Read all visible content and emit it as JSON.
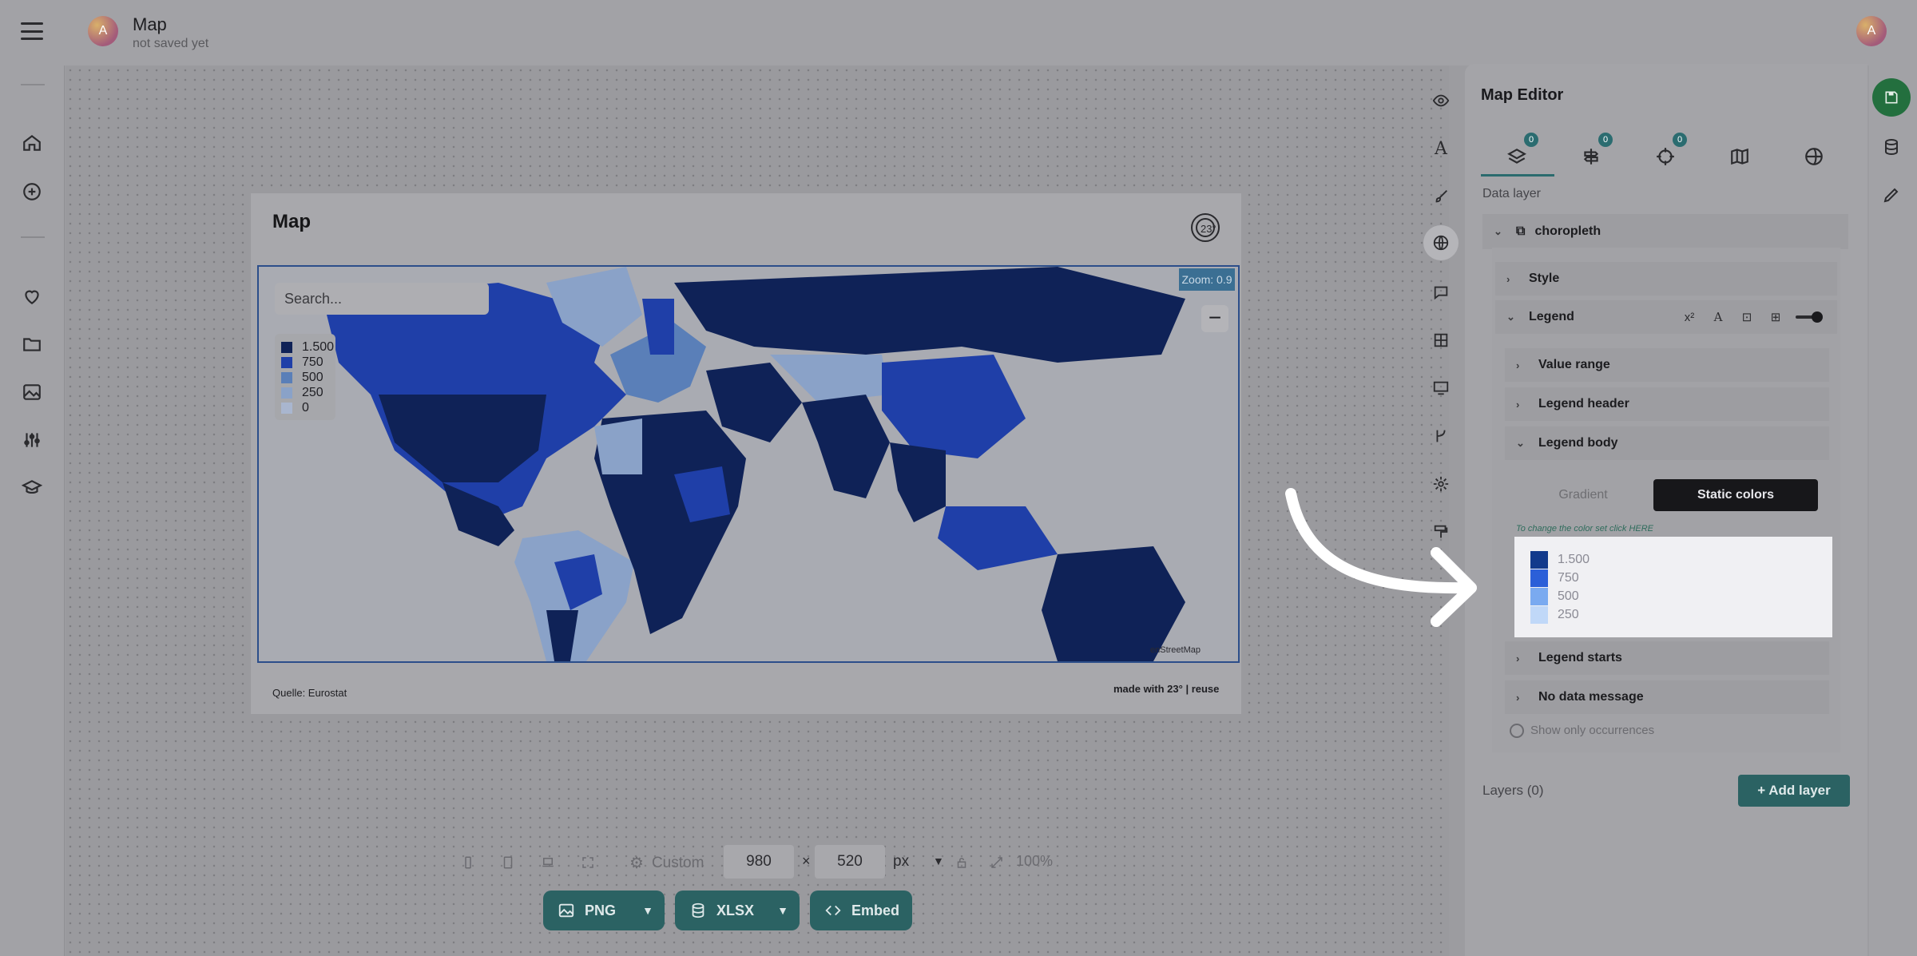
{
  "header": {
    "title": "Map",
    "subtitle": "not saved yet",
    "avatar_letter": "A",
    "user_avatar_letter": "A"
  },
  "rail": {
    "icons": [
      "home-icon",
      "plus-circle-icon",
      "heart-icon",
      "folder-icon",
      "image-icon",
      "sliders-icon",
      "graduation-cap-icon"
    ]
  },
  "card": {
    "title": "Map",
    "search_placeholder": "Search...",
    "legend": [
      {
        "label": "1.500",
        "color": "#0f2257"
      },
      {
        "label": "750",
        "color": "#1f3fa8"
      },
      {
        "label": "500",
        "color": "#5a7fb8"
      },
      {
        "label": "250",
        "color": "#8aa2c8"
      },
      {
        "label": "0",
        "color": "#a9b6cf"
      }
    ],
    "zoom_label": "Zoom: 0.9",
    "zoom_in": "+",
    "zoom_out": "−",
    "attribution": "enStreetMap",
    "source": "Quelle: Eurostat",
    "made_with": "made with 23° | reuse"
  },
  "bottom_toolbar": {
    "preset": "Custom",
    "width": "980",
    "height": "520",
    "times": "×",
    "unit": "px",
    "zoom_percent": "100%",
    "exports": [
      {
        "label": "PNG"
      },
      {
        "label": "XLSX"
      },
      {
        "label": "Embed"
      }
    ]
  },
  "panel": {
    "title": "Map Editor",
    "tabs": [
      {
        "icon": "layers-icon",
        "badge": "0"
      },
      {
        "icon": "signpost-icon",
        "badge": "0"
      },
      {
        "icon": "crosshair-icon",
        "badge": "0"
      },
      {
        "icon": "map-icon",
        "badge": ""
      },
      {
        "icon": "globe-icon",
        "badge": ""
      }
    ],
    "section_label": "Data layer",
    "layer_name": "choropleth",
    "style_label": "Style",
    "legend_label": "Legend",
    "legend_tools": [
      "x²",
      "A",
      "⊡",
      "⊞"
    ],
    "value_range": "Value range",
    "legend_header": "Legend header",
    "legend_body": "Legend body",
    "gradient_label": "Gradient",
    "static_label": "Static colors",
    "hint": "To change the color set click HERE",
    "static_legend": [
      {
        "label": "1.500",
        "color": "#123a8c"
      },
      {
        "label": "750",
        "color": "#2b5fd8"
      },
      {
        "label": "500",
        "color": "#7aaaf0"
      },
      {
        "label": "250",
        "color": "#c0d8f8"
      }
    ],
    "legend_starts": "Legend starts",
    "no_data_message": "No data message",
    "show_only_occurrences": "Show only occurrences",
    "layers_label": "Layers (0)",
    "add_layer": "+ Add layer"
  },
  "colors": {
    "accent": "#2b6263",
    "save": "#236f3e",
    "map_dark": "#0f2257"
  }
}
